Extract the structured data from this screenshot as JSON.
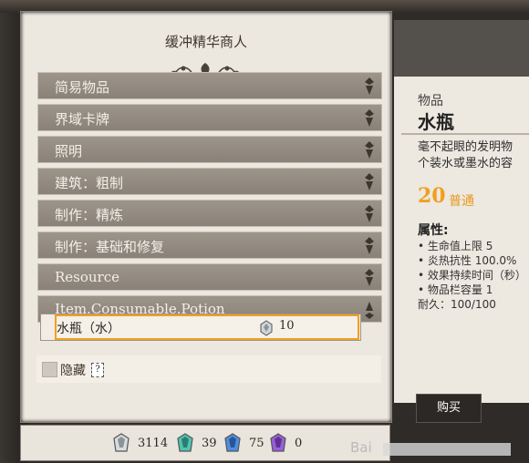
{
  "merchant": {
    "title": "缓冲精华商人"
  },
  "categories": [
    {
      "label": "简易物品"
    },
    {
      "label": "界域卡牌"
    },
    {
      "label": "照明"
    },
    {
      "label": "建筑：粗制"
    },
    {
      "label": "制作：精炼"
    },
    {
      "label": "制作：基础和修复"
    },
    {
      "label": "Resource"
    },
    {
      "label": "Item.Consumable.Potion"
    }
  ],
  "items": [
    {
      "name": "水瓶（水）",
      "price": "10"
    }
  ],
  "hide": {
    "label": "隐藏",
    "help": "?"
  },
  "currencies": [
    {
      "icon": "white-essence-icon",
      "value": "3114",
      "color": "#d8dde0"
    },
    {
      "icon": "green-essence-icon",
      "value": "39",
      "color": "#4fc4b0"
    },
    {
      "icon": "blue-essence-icon",
      "value": "75",
      "color": "#4f8ee0"
    },
    {
      "icon": "purple-essence-icon",
      "value": "0",
      "color": "#9a5fd8"
    }
  ],
  "detail": {
    "type": "物品",
    "name": "水瓶",
    "desc_line1": "毫不起眼的发明物",
    "desc_line2": "个装水或墨水的容",
    "price": "20",
    "rarity": "普通",
    "attr_title": "属性:",
    "stats": [
      "• 生命值上限  5",
      "• 炎热抗性  100.0%",
      "• 效果持续时间（秒）",
      "• 物品栏容量  1",
      "耐久：100/100"
    ],
    "buy_label": "购买"
  },
  "watermark": "Bai"
}
